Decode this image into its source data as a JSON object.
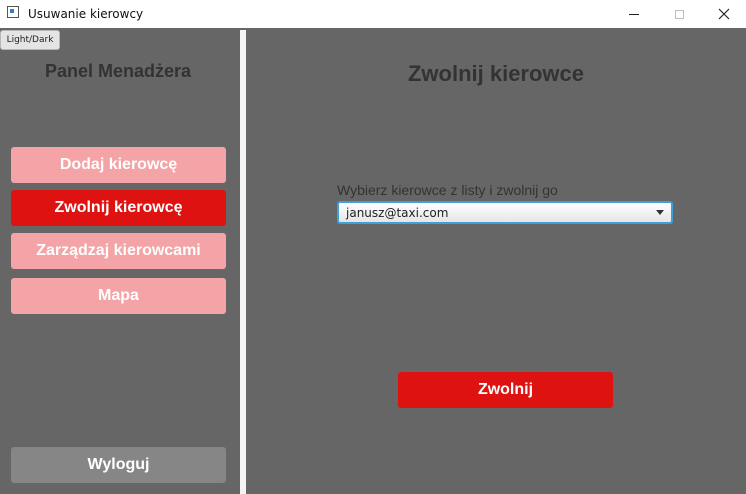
{
  "window": {
    "title": "Usuwanie kierowcy"
  },
  "theme_toggle": {
    "label": "Light/Dark"
  },
  "sidebar": {
    "title": "Panel Menadżera",
    "items": [
      {
        "label": "Dodaj kierowcę",
        "active": false
      },
      {
        "label": "Zwolnij kierowcę",
        "active": true
      },
      {
        "label": "Zarządzaj kierowcami",
        "active": false
      },
      {
        "label": "Mapa",
        "active": false
      }
    ],
    "logout_label": "Wyloguj"
  },
  "main": {
    "title": "Zwolnij kierowce",
    "select_label": "Wybierz kierowce z listy i zwolnij go",
    "select_value": "janusz@taxi.com",
    "fire_label": "Zwolnij"
  },
  "colors": {
    "accent": "#df1212",
    "accent_light": "#f4a3a6",
    "background": "#666666",
    "logout": "#868686"
  }
}
